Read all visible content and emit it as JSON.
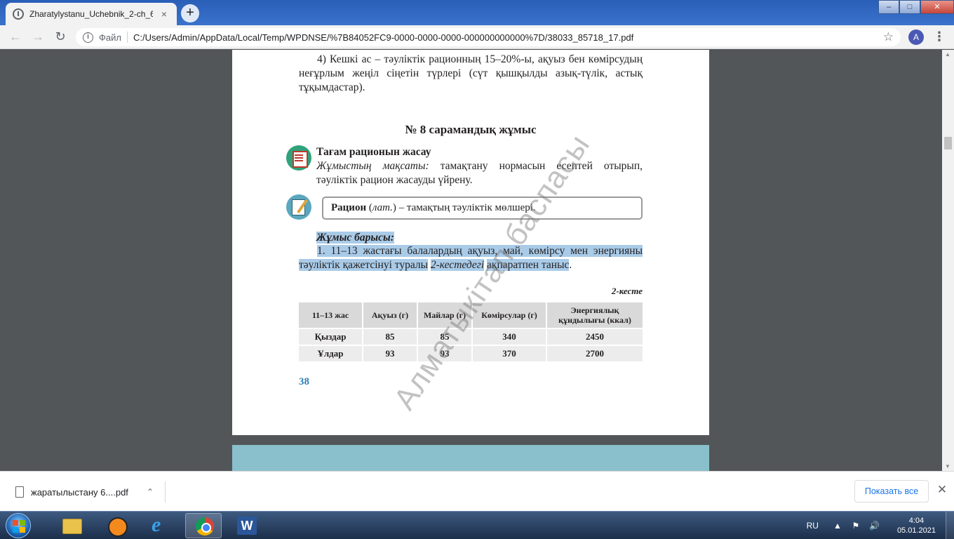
{
  "browser": {
    "tab_title": "Zharatylystanu_Uchebnik_2-ch_6",
    "tab_close": "×",
    "newtab": "+",
    "window_buttons": {
      "minimize": "–",
      "maximize": "□",
      "close": "✕"
    },
    "nav": {
      "back": "←",
      "forward": "→",
      "reload": "↻"
    },
    "address": {
      "info": "i",
      "scheme": "Файл",
      "url": "C:/Users/Admin/AppData/Local/Temp/WPDNSE/%7B84052FC9-0000-0000-0000-000000000000%7D/38033_85718_17.pdf"
    },
    "bookmark_icon": "☆",
    "avatar_letter": "A",
    "menu_icon": "⋮"
  },
  "pdf_page": {
    "paragraph_4": "4) Кешкі ас – тәуліктік рационның 15–20%-ы, ақуыз бен көмірсудың неғұрлым жеңіл сіңетін түрлері (сүт қышқылды азық-түлік, астық тұқымдастар).",
    "heading": "№ 8 сарамандық жұмыс",
    "task_title": "Тағам рационын жасау",
    "goal_label": "Жұмыстың мақсаты:",
    "goal_text": "тамақтану нормасын есептей отырып, тәуліктік рацион жасауды үйрену.",
    "definition_term": "Рацион",
    "definition_note": "лат.",
    "definition_text": "– тамақтың тәуліктік мөлшері.",
    "procedure_title": "Жұмыс барысы:",
    "procedure_text_highlighted": "1. 11–13 жастағы балалардың ақуыз, май, көмірсу мен энергияны тәуліктік қажетсінуі туралы",
    "procedure_text_italic": "2-кестедегі",
    "procedure_text_end": "ақпаратпен таныс",
    "procedure_text_period": ".",
    "table_caption": "2-кесте",
    "table": {
      "headers": [
        "11–13 жас",
        "Ақуыз (г)",
        "Майлар (г)",
        "Көмірсулар (г)",
        "Энергиялық құндылығы (ккал)"
      ],
      "rows": [
        [
          "Қыздар",
          "85",
          "85",
          "340",
          "2450"
        ],
        [
          "Ұлдар",
          "93",
          "93",
          "370",
          "2700"
        ]
      ]
    },
    "page_number": "38",
    "watermark": "Алматыкітап баспасы"
  },
  "downloads": {
    "file_name": "жаратылыстану 6....pdf",
    "chevron": "⌃",
    "show_all": "Показать все",
    "close": "✕"
  },
  "taskbar": {
    "language": "RU",
    "tray_up": "▲",
    "tray_flag": "⚑",
    "tray_volume": "🔊",
    "time": "4:04",
    "date": "05.01.2021"
  }
}
